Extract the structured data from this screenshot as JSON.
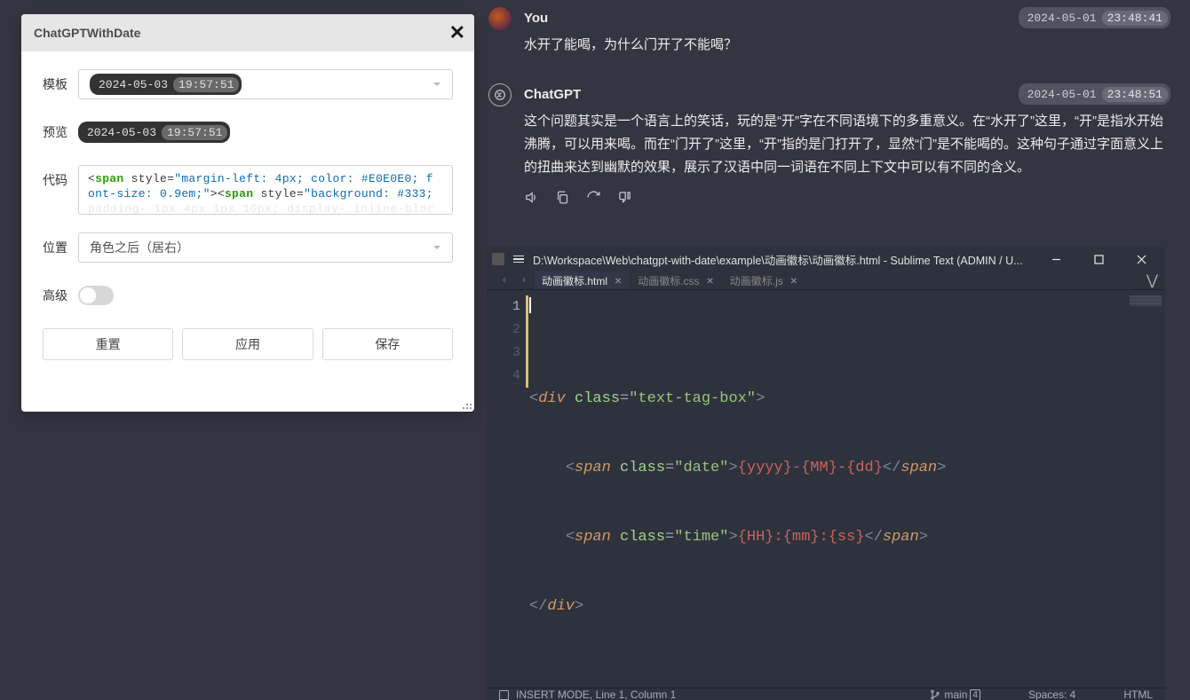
{
  "dialog": {
    "title": "ChatGPTWithDate",
    "labels": {
      "template": "模板",
      "preview": "预览",
      "code": "代码",
      "position": "位置",
      "advanced": "高级"
    },
    "template_badge": {
      "date": "2024-05-03",
      "time": "19:57:51"
    },
    "preview_badge": {
      "date": "2024-05-03",
      "time": "19:57:51"
    },
    "code_line1_a": "span",
    "code_line1_b": " style=",
    "code_line1_c": "\"margin-left: 4px; color: #E0E0E0; f",
    "code_line2_a": "ont-size: 0.9em;\"",
    "code_line2_b": "span",
    "code_line2_c": " style=",
    "code_line2_d": "\"background: #333;",
    "code_line3": "padding- 1px 4px 1px 10px; display- inline-bloc",
    "position_value": "角色之后（居右）",
    "buttons": {
      "reset": "重置",
      "apply": "应用",
      "save": "保存"
    }
  },
  "chat": {
    "user": {
      "name": "You",
      "date": "2024-05-01",
      "time": "23:48:41",
      "text": "水开了能喝，为什么门开了不能喝？"
    },
    "bot": {
      "name": "ChatGPT",
      "date": "2024-05-01",
      "time": "23:48:51",
      "text": "这个问题其实是一个语言上的笑话，玩的是“开”字在不同语境下的多重意义。在“水开了”这里，“开”是指水开始沸腾，可以用来喝。而在“门开了”这里，“开”指的是门打开了，显然“门”是不能喝的。这种句子通过字面意义上的扭曲来达到幽默的效果，展示了汉语中同一词语在不同上下文中可以有不同的含义。"
    }
  },
  "sublime": {
    "title": "D:\\Workspace\\Web\\chatgpt-with-date\\example\\动画徽标\\动画徽标.html - Sublime Text (ADMIN / U...",
    "tabs": [
      "动画徽标.html",
      "动画徽标.css",
      "动画徽标.js"
    ],
    "status": {
      "mode": "INSERT MODE, Line 1, Column 1",
      "branch": "main",
      "branch_num": "4",
      "spaces": "Spaces: 4",
      "lang": "HTML"
    },
    "code": {
      "l1": {
        "tag": "div",
        "attr": "class",
        "str": "\"text-tag-box\""
      },
      "l2": {
        "tag": "span",
        "attr": "class",
        "str": "\"date\"",
        "tpl": "{yyyy}-{MM}-{dd}"
      },
      "l3": {
        "tag": "span",
        "attr": "class",
        "str": "\"time\"",
        "tpl": "{HH}:{mm}:{ss}"
      },
      "l4": {
        "tag": "div"
      }
    }
  }
}
